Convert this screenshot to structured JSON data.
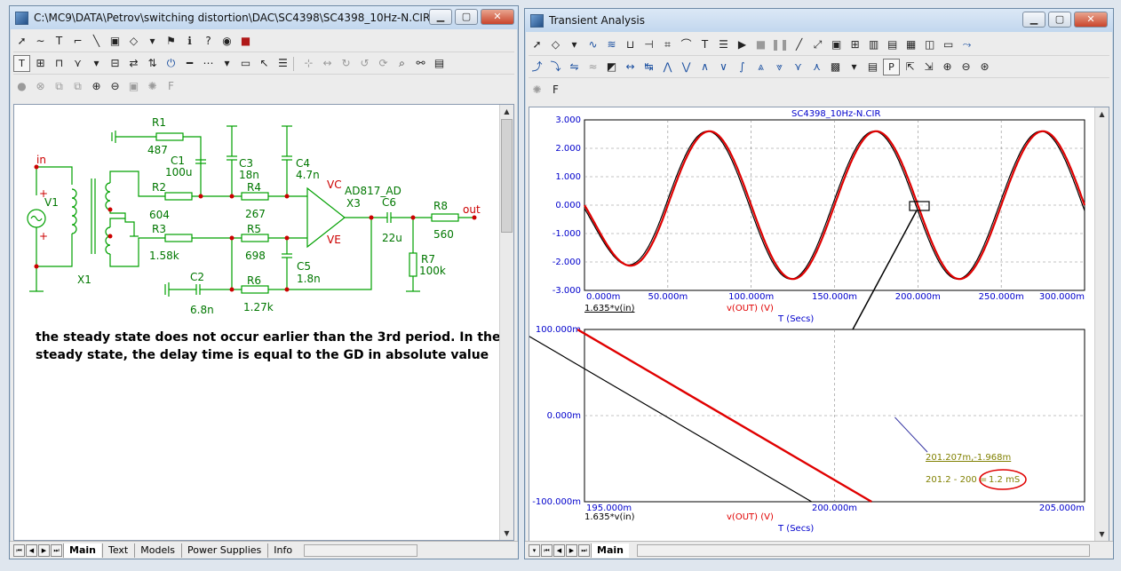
{
  "left_window": {
    "title": "C:\\MC9\\DATA\\Petrov\\switching distortion\\DAC\\SC4398\\SC4398_10Hz-N.CIR",
    "tabs": [
      "Main",
      "Text",
      "Models",
      "Power Supplies",
      "Info"
    ],
    "active_tab": "Main",
    "note_line1": "the steady state does not occur earlier than the 3rd period. In the",
    "note_line2": "steady state, the delay time is equal to the GD in absolute value",
    "schematic": {
      "node_in": "in",
      "node_out": "out",
      "vc": "VC",
      "ve": "VE",
      "V1": "V1",
      "X1": "X1",
      "X3": "X3",
      "opamp": "AD817_AD",
      "R1": "R1",
      "R1v": "487",
      "R2": "R2",
      "R2v": "604",
      "R3": "R3",
      "R3v": "1.58k",
      "R4": "R4",
      "R4v": "267",
      "R5": "R5",
      "R5v": "698",
      "R6": "R6",
      "R6v": "1.27k",
      "R7": "R7",
      "R7v": "100k",
      "R8": "R8",
      "R8v": "560",
      "C1": "C1",
      "C1v": "100u",
      "C2": "C2",
      "C2v": "6.8n",
      "C3": "C3",
      "C3v": "18n",
      "C4": "C4",
      "C4v": "4.7n",
      "C5": "C5",
      "C5v": "1.8n",
      "C6": "C6",
      "C6v": "22u"
    }
  },
  "right_window": {
    "title": "Transient Analysis",
    "tabs": [
      "Main"
    ],
    "active_tab": "Main"
  },
  "colors": {
    "trace1": "#000000",
    "trace2": "#e00000",
    "axis_text": "#0000cc",
    "label_text": "#808000",
    "plus": "#ff0000",
    "schematic_wire": "#00a000",
    "component_text": "#007700",
    "node": "#cc0000"
  },
  "chart_data": [
    {
      "type": "line",
      "title": "SC4398_10Hz-N.CIR",
      "xlabel": "T (Secs)",
      "x_ticks": [
        "0.000m",
        "50.000m",
        "100.000m",
        "150.000m",
        "200.000m",
        "250.000m",
        "300.000m"
      ],
      "y_ticks": [
        "3.000",
        "2.000",
        "1.000",
        "0.000",
        "-1.000",
        "-2.000",
        "-3.000"
      ],
      "xlim": [
        0,
        300
      ],
      "ylim": [
        -3,
        3
      ],
      "grid": true,
      "series": [
        {
          "name": "1.635*v(in)",
          "color": "#000000",
          "amplitude": 2.6,
          "frequency_hz": 10,
          "lead_ms": 1.2
        },
        {
          "name": "v(OUT) (V)",
          "color": "#e00000",
          "amplitude": 2.6,
          "frequency_hz": 10,
          "lead_ms": 0
        }
      ]
    },
    {
      "type": "line",
      "xlabel": "T (Secs)",
      "x_ticks": [
        "195.000m",
        "200.000m",
        "205.000m"
      ],
      "y_ticks": [
        "100.000m",
        "0.000m",
        "-100.000m"
      ],
      "xlim": [
        195,
        205
      ],
      "ylim": [
        -100,
        100
      ],
      "grid": true,
      "series": [
        {
          "name": "1.635*v(in)",
          "color": "#000000",
          "x": [
            191.6,
            201.6
          ],
          "y": [
            170,
            -170
          ]
        },
        {
          "name": "v(OUT) (V)",
          "color": "#e00000",
          "x": [
            192.8,
            202.8
          ],
          "y": [
            170,
            -170
          ]
        }
      ],
      "annotations": [
        {
          "text": "201.207m,-1.968m",
          "x": 201.207,
          "y": -1.968
        },
        {
          "text": "201.2 - 200 =",
          "highlight": "1.2 mS"
        }
      ]
    }
  ]
}
